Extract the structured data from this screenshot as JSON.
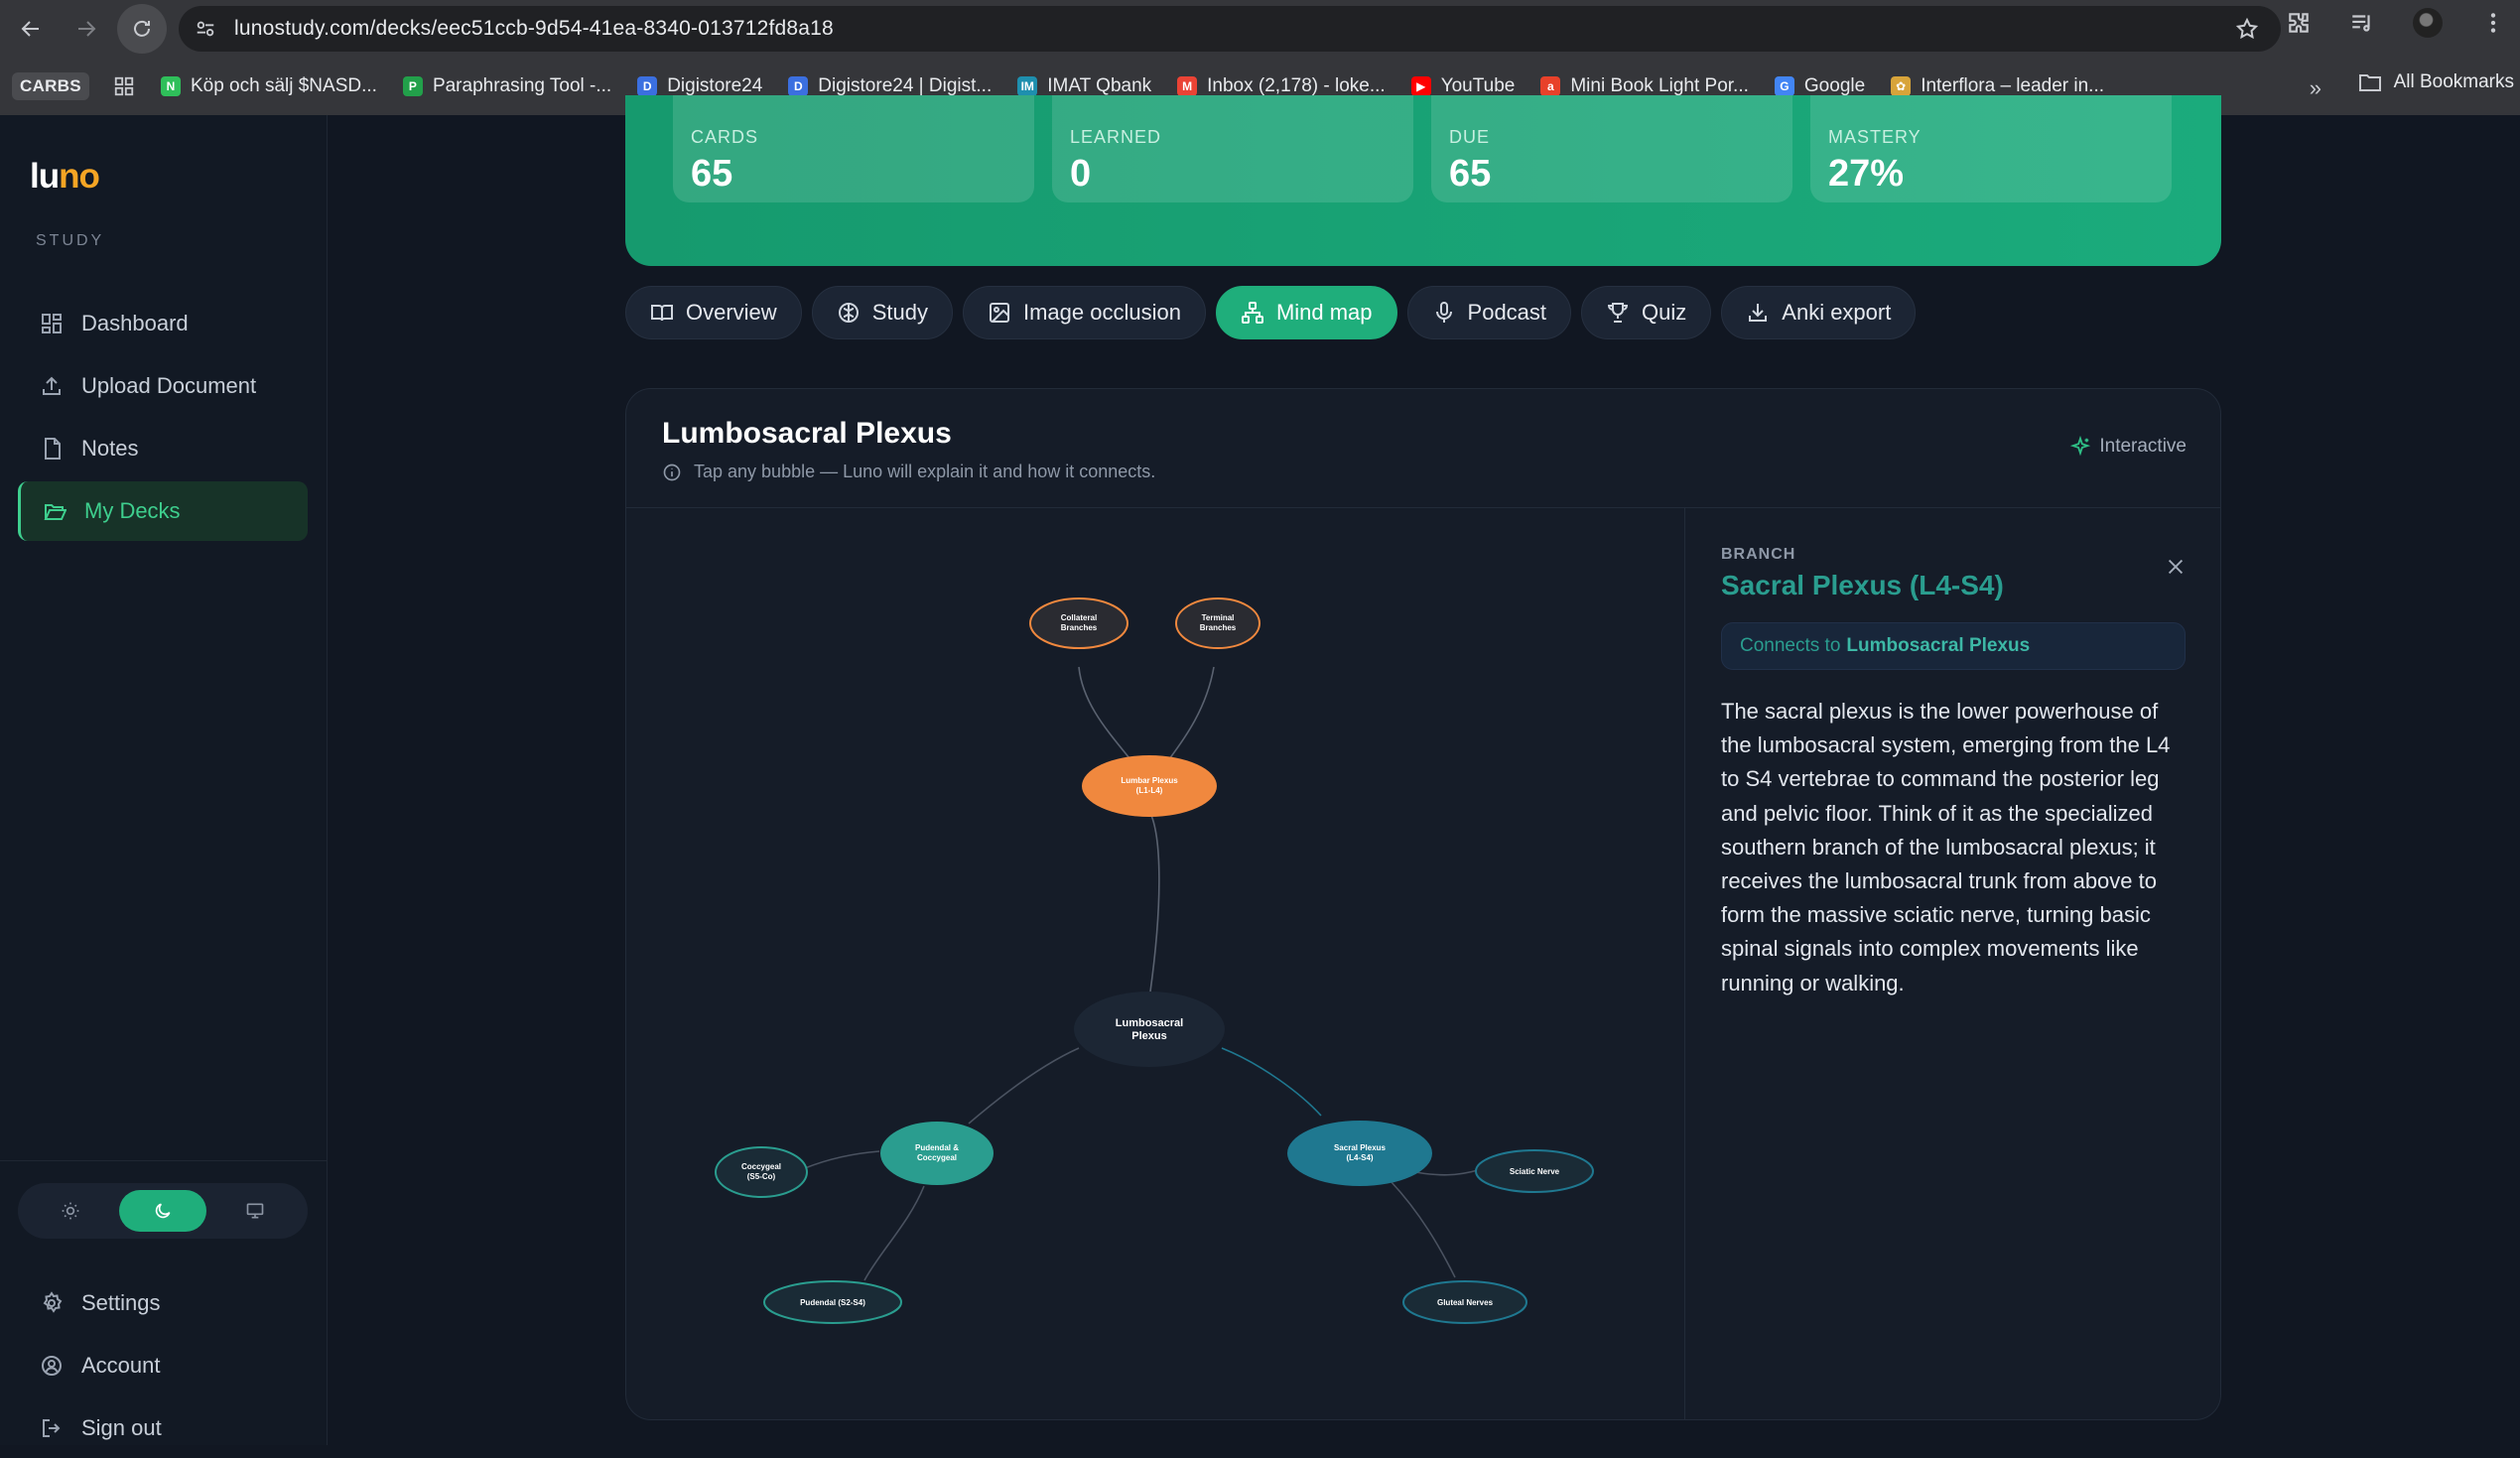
{
  "browser": {
    "url": "lunostudy.com/decks/eec51ccb-9d54-41ea-8340-013712fd8a18",
    "bookmarks_badge": "CARBS",
    "bookmarks": [
      {
        "label": "Köp och sälj $NASD...",
        "color": "#2fbf5a",
        "glyph": "N"
      },
      {
        "label": "Paraphrasing Tool -...",
        "color": "#22a04a",
        "glyph": "P"
      },
      {
        "label": "Digistore24",
        "color": "#3b6fe0",
        "glyph": "D"
      },
      {
        "label": "Digistore24 | Digist...",
        "color": "#3b6fe0",
        "glyph": "D"
      },
      {
        "label": "IMAT Qbank",
        "color": "#1e8fae",
        "glyph": "IM"
      },
      {
        "label": "Inbox (2,178) - loke...",
        "color": "#ea4335",
        "glyph": "M"
      },
      {
        "label": "YouTube",
        "color": "#ff0000",
        "glyph": "▶"
      },
      {
        "label": "Mini Book Light Por...",
        "color": "#e8412a",
        "glyph": "a"
      },
      {
        "label": "Google",
        "color": "#4285f4",
        "glyph": "G"
      },
      {
        "label": "Interflora – leader in...",
        "color": "#d8a43a",
        "glyph": "✿"
      }
    ],
    "all_bookmarks": "All Bookmarks"
  },
  "sidebar": {
    "logo_a": "lu",
    "logo_b": "no",
    "section": "STUDY",
    "items": [
      {
        "label": "Dashboard",
        "icon": "dashboard-icon"
      },
      {
        "label": "Upload Document",
        "icon": "upload-icon"
      },
      {
        "label": "Notes",
        "icon": "file-icon"
      },
      {
        "label": "My Decks",
        "icon": "folder-open-icon"
      }
    ],
    "bottom": [
      {
        "label": "Settings",
        "icon": "gear-icon"
      },
      {
        "label": "Account",
        "icon": "user-circle-icon"
      },
      {
        "label": "Sign out",
        "icon": "sign-out-icon"
      }
    ],
    "theme": "dark"
  },
  "stats": [
    {
      "label": "CARDS",
      "value": "65"
    },
    {
      "label": "LEARNED",
      "value": "0"
    },
    {
      "label": "DUE",
      "value": "65"
    },
    {
      "label": "MASTERY",
      "value": "27%"
    }
  ],
  "tabs": [
    {
      "label": "Overview",
      "icon": "book-icon"
    },
    {
      "label": "Study",
      "icon": "brain-icon"
    },
    {
      "label": "Image occlusion",
      "icon": "image-icon"
    },
    {
      "label": "Mind map",
      "icon": "network-icon"
    },
    {
      "label": "Podcast",
      "icon": "mic-icon"
    },
    {
      "label": "Quiz",
      "icon": "trophy-icon"
    },
    {
      "label": "Anki export",
      "icon": "download-icon"
    }
  ],
  "active_tab": "Mind map",
  "mindmap": {
    "title": "Lumbosacral Plexus",
    "subtitle": "Tap any bubble — Luno will explain it and how it connects.",
    "badge": "Interactive",
    "nodes": {
      "root": [
        "Lumbosacral",
        "Plexus"
      ],
      "lumbar": [
        "Lumbar Plexus",
        "(L1-L4)"
      ],
      "collateral": [
        "Collateral",
        "Branches"
      ],
      "terminal": [
        "Terminal",
        "Branches"
      ],
      "sacral": [
        "Sacral Plexus",
        "(L4-S4)"
      ],
      "sciatic": [
        "Sciatic Nerve"
      ],
      "gluteal": [
        "Gluteal Nerves"
      ],
      "pudendal_coccygeal": [
        "Pudendal &",
        "Coccygeal"
      ],
      "coccygeal": [
        "Coccygeal",
        "(S5-Co)"
      ],
      "pudendal": [
        "Pudendal (S2-S4)"
      ]
    },
    "colors": {
      "orange": "#f0883e",
      "teal": "#2a9d8f",
      "cyan": "#1f7890",
      "dark_node": "#1c2634"
    }
  },
  "detail": {
    "kicker": "BRANCH",
    "title": "Sacral Plexus (L4-S4)",
    "connects_prefix": "Connects to",
    "connects_target": "Lumbosacral Plexus",
    "description": "The sacral plexus is the lower powerhouse of the lumbosacral system, emerging from the L4 to S4 vertebrae to command the posterior leg and pelvic floor. Think of it as the specialized southern branch of the lumbosacral plexus; it receives the lumbosacral trunk from above to form the massive sciatic nerve, turning basic spinal signals into complex movements like running or walking."
  }
}
